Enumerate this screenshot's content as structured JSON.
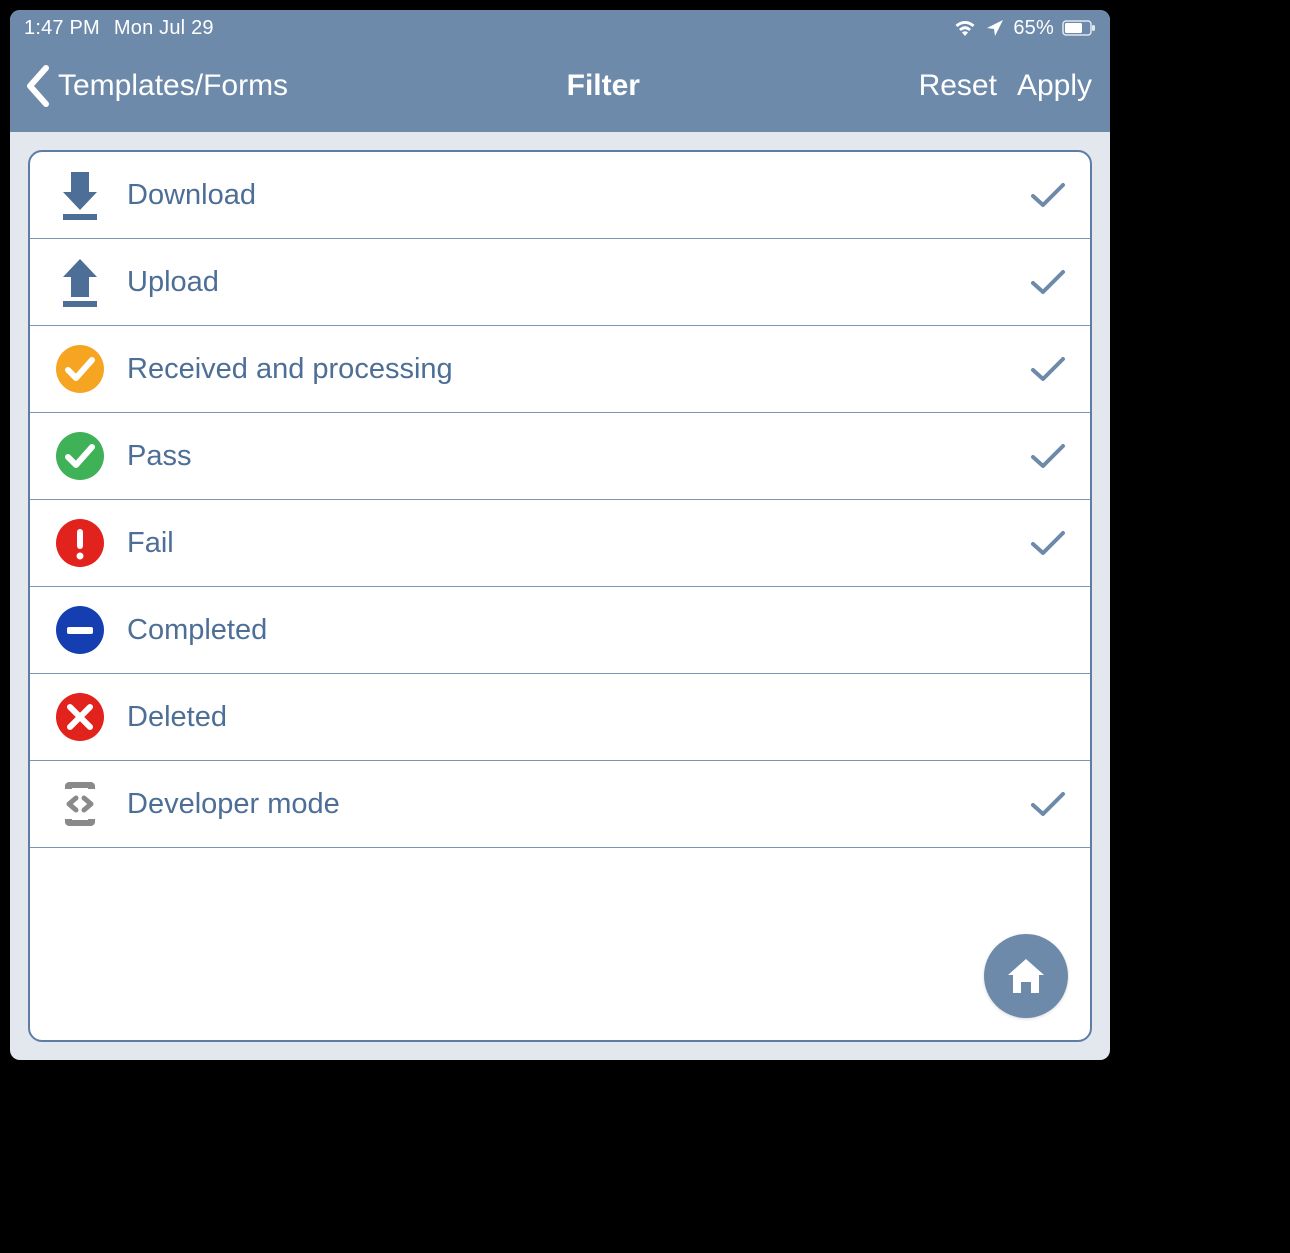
{
  "status": {
    "time": "1:47 PM",
    "date": "Mon Jul 29",
    "battery_pct": "65%"
  },
  "nav": {
    "back_label": "Templates/Forms",
    "title": "Filter",
    "reset_label": "Reset",
    "apply_label": "Apply"
  },
  "filters": [
    {
      "icon": "download",
      "label": "Download",
      "selected": true
    },
    {
      "icon": "upload",
      "label": "Upload",
      "selected": true
    },
    {
      "icon": "processing",
      "label": "Received and processing",
      "selected": true
    },
    {
      "icon": "pass",
      "label": "Pass",
      "selected": true
    },
    {
      "icon": "fail",
      "label": "Fail",
      "selected": true
    },
    {
      "icon": "completed",
      "label": "Completed",
      "selected": false
    },
    {
      "icon": "deleted",
      "label": "Deleted",
      "selected": false
    },
    {
      "icon": "devmode",
      "label": "Developer mode",
      "selected": true
    }
  ],
  "colors": {
    "primary": "#6d8aab",
    "text": "#4d6e96",
    "orange": "#f6a522",
    "green": "#3fb157",
    "red": "#e1221d",
    "blue": "#153fb0",
    "gray": "#8a8a8a"
  }
}
